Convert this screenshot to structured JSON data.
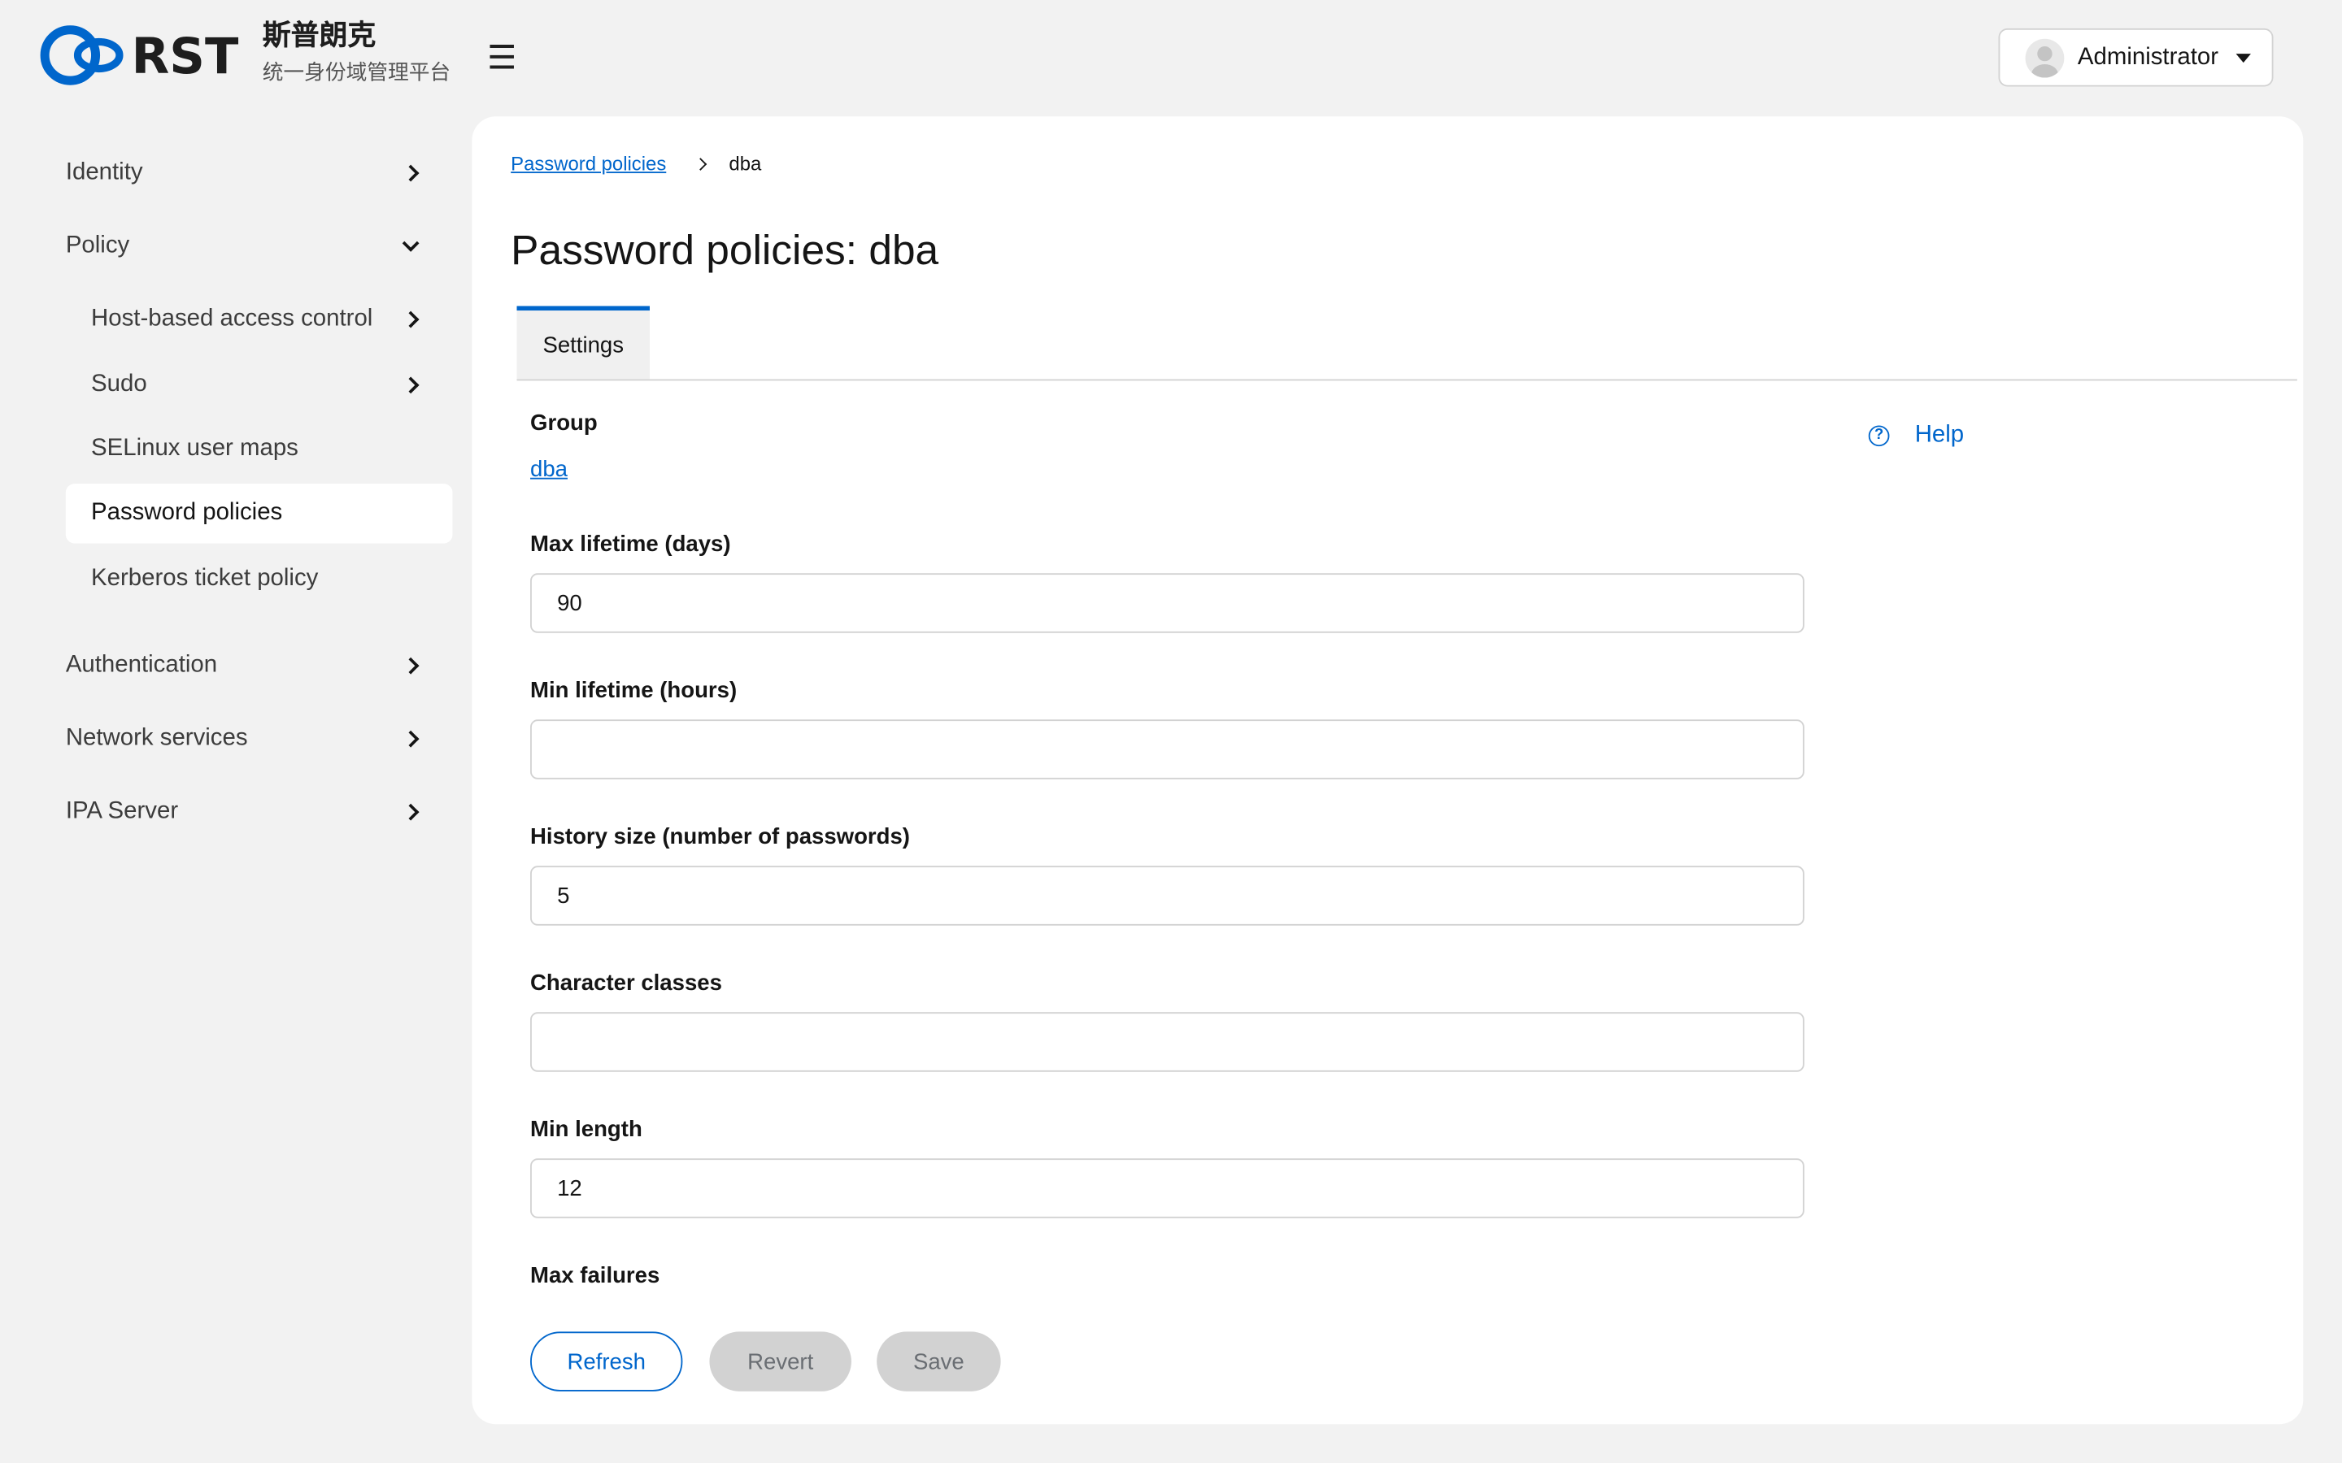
{
  "brand": {
    "logo_text": "RST",
    "name_cn": "斯普朗克",
    "subtitle_cn": "统一身份域管理平台",
    "accent": "#0066cc"
  },
  "header": {
    "menu_icon": "☰",
    "user_name": "Administrator"
  },
  "sidebar": {
    "items": [
      {
        "label": "Identity",
        "icon": "chevron-right-icon"
      },
      {
        "label": "Policy",
        "icon": "chevron-down-icon",
        "expanded": true
      },
      {
        "label": "Host-based access control",
        "icon": "chevron-right-icon"
      },
      {
        "label": "Sudo",
        "icon": "chevron-right-icon"
      },
      {
        "label": "SELinux user maps"
      },
      {
        "label": "Password policies",
        "active": true
      },
      {
        "label": "Kerberos ticket policy"
      },
      {
        "label": "Authentication",
        "icon": "chevron-right-icon"
      },
      {
        "label": "Network services",
        "icon": "chevron-right-icon"
      },
      {
        "label": "IPA Server",
        "icon": "chevron-right-icon"
      }
    ]
  },
  "breadcrumb": {
    "parent": "Password policies",
    "current": "dba"
  },
  "page": {
    "title": "Password policies: dba"
  },
  "tabs": [
    {
      "label": "Settings",
      "active": true
    }
  ],
  "help": {
    "icon": "?",
    "label": "Help"
  },
  "form": {
    "group": {
      "label": "Group",
      "value": "dba"
    },
    "max_lifetime": {
      "label": "Max lifetime (days)",
      "value": "90"
    },
    "min_lifetime": {
      "label": "Min lifetime (hours)",
      "value": ""
    },
    "history_size": {
      "label": "History size (number of passwords)",
      "value": "5"
    },
    "character_classes": {
      "label": "Character classes",
      "value": ""
    },
    "min_length": {
      "label": "Min length",
      "value": "12"
    },
    "max_failures": {
      "label": "Max failures"
    }
  },
  "actions": {
    "refresh": "Refresh",
    "revert": "Revert",
    "save": "Save"
  }
}
